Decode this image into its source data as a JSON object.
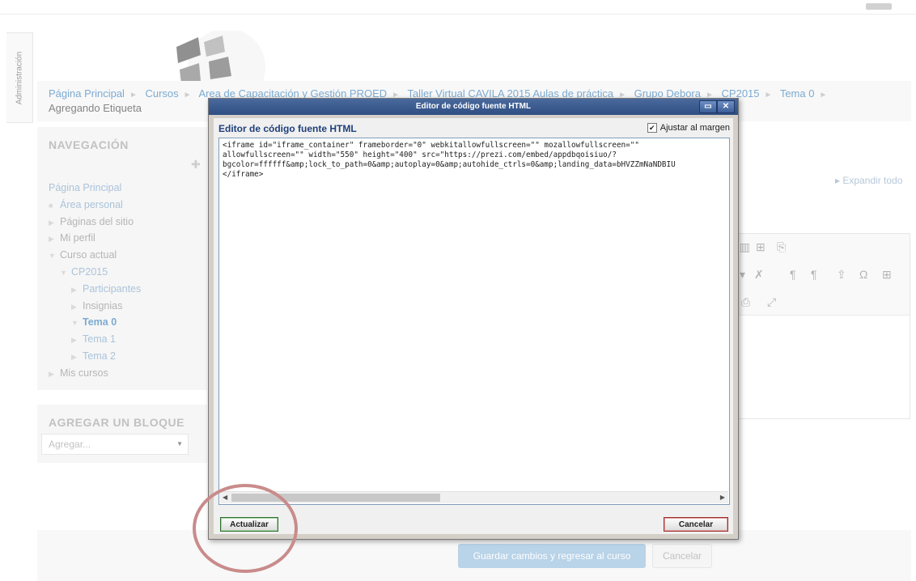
{
  "admin_tab": "Administración",
  "breadcrumb": {
    "items": [
      "Página Principal",
      "Cursos",
      "Area de Capacitación y Gestión PROED",
      "Taller Virtual CAVILA 2015 Aulas de práctica",
      "Grupo Debora",
      "CP2015",
      "Tema 0"
    ],
    "current": "Agregando Etiqueta"
  },
  "navigation": {
    "title": "NAVEGACIÓN",
    "items": [
      {
        "label": "Página Principal"
      },
      {
        "label": "Área personal"
      },
      {
        "label": "Páginas del sitio"
      },
      {
        "label": "Mi perfil"
      },
      {
        "label": "Curso actual"
      },
      {
        "label": "CP2015"
      },
      {
        "label": "Participantes"
      },
      {
        "label": "Insignias"
      },
      {
        "label": "Tema 0"
      },
      {
        "label": "Tema 1"
      },
      {
        "label": "Tema 2"
      },
      {
        "label": "Mis cursos"
      }
    ]
  },
  "add_block": {
    "title": "AGREGAR UN BLOQUE",
    "select_value": "Agregar..."
  },
  "expand_all": "Expandir todo",
  "form_buttons": {
    "save": "Guardar cambios y regresar al curso",
    "cancel": "Cancelar"
  },
  "dialog": {
    "window_title": "Editor de código fuente HTML",
    "heading": "Editor de código fuente HTML",
    "wrap_label": "Ajustar al margen",
    "wrap_checked": true,
    "code": "<iframe id=\"iframe_container\" frameborder=\"0\" webkitallowfullscreen=\"\" mozallowfullscreen=\"\"\nallowfullscreen=\"\" width=\"550\" height=\"400\" src=\"https://prezi.com/embed/appdbqoisiuo/?\nbgcolor=ffffff&amp;lock_to_path=0&amp;autoplay=0&amp;autohide_ctrls=0&amp;landing_data=bHVZZmNaNDBIU\n</iframe>",
    "update_button": "Actualizar",
    "cancel_button": "Cancelar"
  }
}
